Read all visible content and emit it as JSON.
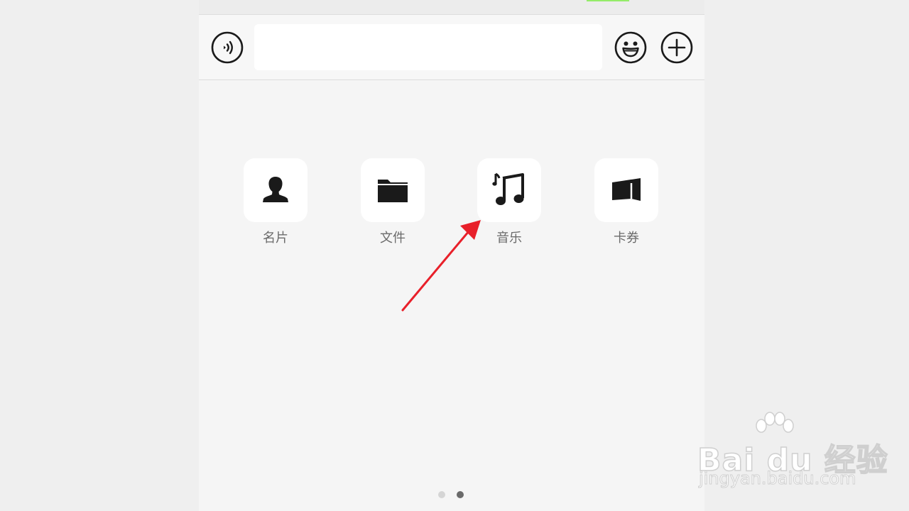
{
  "input_bar": {
    "message_value": "",
    "voice_icon": "voice-icon",
    "emoji_icon": "emoji-icon",
    "plus_icon": "plus-icon"
  },
  "panel": {
    "items": [
      {
        "label": "名片",
        "icon": "contact-card-icon"
      },
      {
        "label": "文件",
        "icon": "folder-icon"
      },
      {
        "label": "音乐",
        "icon": "music-icon"
      },
      {
        "label": "卡券",
        "icon": "card-coupon-icon"
      }
    ],
    "page_indicator": {
      "pages": 2,
      "active": 2
    }
  },
  "watermark": {
    "brand": "Bai du 经验",
    "url": "jingyan.baidu.com"
  },
  "colors": {
    "arrow": "#e8202a",
    "accent_green": "#95ec69",
    "label_gray": "#6b6b6b"
  }
}
